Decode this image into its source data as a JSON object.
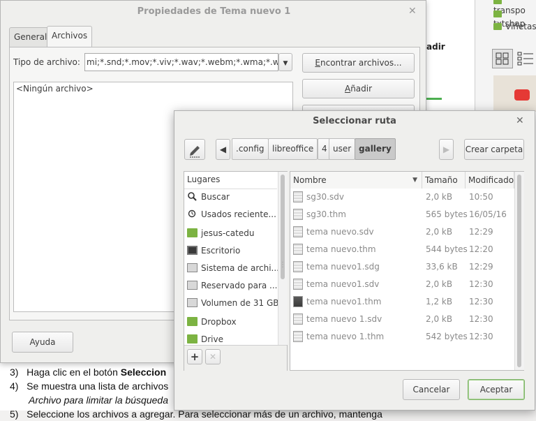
{
  "background_doc": {
    "right_items": [
      "transpo",
      "txtshap",
      "Viñetas"
    ],
    "cut_text": "adir",
    "steps": [
      {
        "num": "3)",
        "text_plain": "Haga clic en el botón ",
        "text_bold": "Seleccion"
      },
      {
        "num": "4)",
        "text_plain": "Se muestra una lista de archivos",
        "text_plain2": "Archivo para limitar la búsqueda"
      },
      {
        "num": "5)",
        "text_plain": "Seleccione los archivos a agregar. Para seleccionar más de un archivo, mantenga"
      }
    ]
  },
  "properties_dialog": {
    "title": "Propiedades de Tema nuevo 1",
    "tabs": [
      "General",
      "Archivos"
    ],
    "file_type_label": "Tipo de archivo:",
    "file_type_value": "mi;*.snd;*.mov;*.viv;*.wav;*.webm;*.wma;*.wmv)",
    "files_empty": "<Ningún archivo>",
    "find_button": "Encontrar archivos...",
    "add_button": "Añadir",
    "help_button": "Ayuda"
  },
  "select_dialog": {
    "title": "Seleccionar ruta",
    "path": [
      ".config",
      "libreoffice",
      "4",
      "user",
      "gallery"
    ],
    "create_folder_button": "Crear carpeta",
    "places_header": "Lugares",
    "places": [
      {
        "icon": "search-icon",
        "label": "Buscar"
      },
      {
        "icon": "history-icon",
        "label": "Usados reciente..."
      },
      {
        "icon": "home-folder-icon",
        "label": "jesus-catedu"
      },
      {
        "icon": "desktop-icon",
        "label": "Escritorio"
      },
      {
        "icon": "drive-icon",
        "label": "Sistema de archi..."
      },
      {
        "icon": "drive-icon",
        "label": "Reservado para ..."
      },
      {
        "icon": "drive-icon",
        "label": "Volumen de 31 GB"
      },
      {
        "icon": "folder-icon",
        "label": "Dropbox"
      },
      {
        "icon": "folder-icon",
        "label": "Drive"
      }
    ],
    "columns": {
      "name": "Nombre",
      "size": "Tamaño",
      "modified": "Modificado"
    },
    "files": [
      {
        "name": "sg30.sdv",
        "size": "2,0 kB",
        "modified": "10:50"
      },
      {
        "name": "sg30.thm",
        "size": "565 bytes",
        "modified": "16/05/16"
      },
      {
        "name": "tema nuevo.sdv",
        "size": "2,0 kB",
        "modified": "12:29"
      },
      {
        "name": "tema nuevo.thm",
        "size": "544 bytes",
        "modified": "12:20"
      },
      {
        "name": "tema nuevo1.sdg",
        "size": "33,6 kB",
        "modified": "12:29"
      },
      {
        "name": "tema nuevo1.sdv",
        "size": "2,0 kB",
        "modified": "12:30"
      },
      {
        "name": "tema nuevo1.thm",
        "size": "1,2 kB",
        "modified": "12:30"
      },
      {
        "name": "tema nuevo 1.sdv",
        "size": "2,0 kB",
        "modified": "12:30"
      },
      {
        "name": "tema nuevo 1.thm",
        "size": "542 bytes",
        "modified": "12:30"
      }
    ],
    "cancel_button": "Cancelar",
    "accept_button": "Aceptar"
  }
}
